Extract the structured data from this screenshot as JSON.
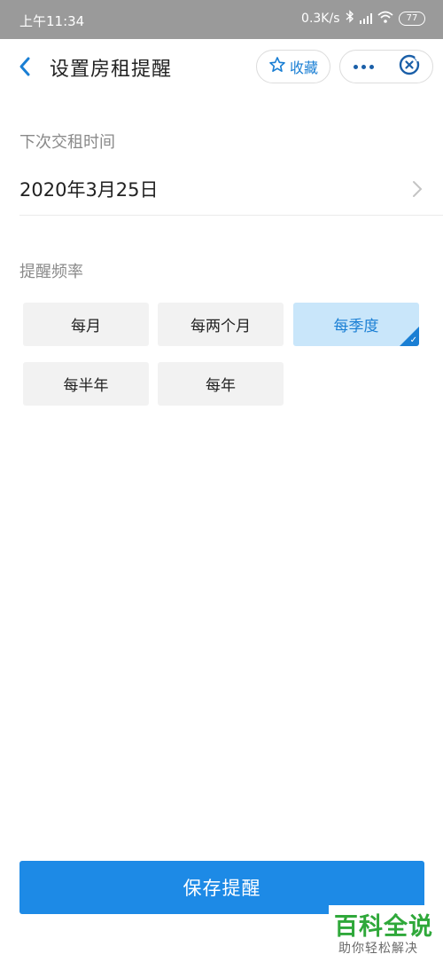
{
  "status_bar": {
    "time": "上午11:34",
    "speed": "0.3K/s",
    "battery": "77"
  },
  "header": {
    "title": "设置房租提醒",
    "favorite_label": "收藏"
  },
  "next_rent": {
    "label": "下次交租时间",
    "date": "2020年3月25日"
  },
  "frequency": {
    "label": "提醒频率",
    "options": [
      "每月",
      "每两个月",
      "每季度",
      "每半年",
      "每年"
    ],
    "selected": "每季度"
  },
  "save_button": "保存提醒",
  "watermark": {
    "title": "百科全说",
    "subtitle": "助你轻松解决"
  },
  "colors": {
    "accent": "#1d8ae6",
    "selected_bg": "#c9e6fa",
    "status_bar": "#9a9a9a",
    "watermark_green": "#2fa83a"
  },
  "icons": [
    "back-arrow-icon",
    "star-icon",
    "more-dots-icon",
    "close-circle-icon",
    "chevron-right-icon",
    "bluetooth-icon",
    "signal-icon",
    "wifi-icon",
    "battery-icon",
    "check-icon"
  ]
}
